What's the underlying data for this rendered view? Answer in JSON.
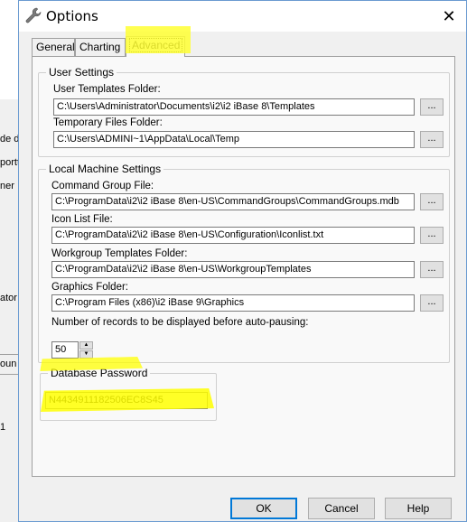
{
  "background": {
    "fragments": [
      "de d",
      "portt",
      "ner",
      "ator",
      "oun",
      "1"
    ]
  },
  "dialog": {
    "title": "Options",
    "close_glyph": "✕",
    "icons": {
      "title": "wrench-icon"
    }
  },
  "tabs": [
    {
      "label": "General",
      "active": false
    },
    {
      "label": "Charting",
      "active": false
    },
    {
      "label": "Advanced",
      "active": true
    }
  ],
  "user_settings": {
    "legend": "User Settings",
    "templates_folder": {
      "label": "User Templates Folder:",
      "value": "C:\\Users\\Administrator\\Documents\\i2\\i2 iBase 8\\Templates",
      "browse": "..."
    },
    "temp_folder": {
      "label": "Temporary Files Folder:",
      "value": "C:\\Users\\ADMINI~1\\AppData\\Local\\Temp",
      "browse": "..."
    }
  },
  "local_machine": {
    "legend": "Local Machine Settings",
    "command_group": {
      "label": "Command Group File:",
      "value": "C:\\ProgramData\\i2\\i2 iBase 8\\en-US\\CommandGroups\\CommandGroups.mdb",
      "browse": "..."
    },
    "icon_list": {
      "label": "Icon List File:",
      "value": "C:\\ProgramData\\i2\\i2 iBase 8\\en-US\\Configuration\\Iconlist.txt",
      "browse": "..."
    },
    "workgroup_templates": {
      "label": "Workgroup Templates Folder:",
      "value": "C:\\ProgramData\\i2\\i2 iBase 8\\en-US\\WorkgroupTemplates",
      "browse": "..."
    },
    "graphics": {
      "label": "Graphics Folder:",
      "value": "C:\\Program Files (x86)\\i2 iBase 9\\Graphics",
      "browse": "..."
    },
    "records_label": "Number of records to be displayed before auto-pausing:",
    "records_value": "50"
  },
  "database_password": {
    "legend": "Database Password",
    "value": "N4434911182506EC8S45"
  },
  "buttons": {
    "ok": "OK",
    "cancel": "Cancel",
    "help": "Help"
  },
  "highlight_color": "#ffff00",
  "accent_color": "#0078d7"
}
